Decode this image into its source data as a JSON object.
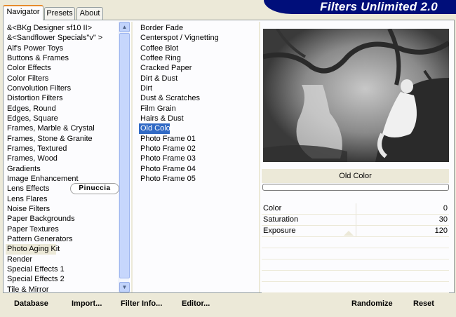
{
  "app": {
    "title": "Filters Unlimited 2.0"
  },
  "tabs": [
    {
      "label": "Navigator",
      "active": true
    },
    {
      "label": "Presets",
      "active": false
    },
    {
      "label": "About",
      "active": false
    }
  ],
  "categories": [
    "&<BKg Designer sf10 II>",
    "&<Sandflower Specials\"v\" >",
    "Alf's Power Toys",
    "Buttons & Frames",
    "Color Effects",
    "Color Filters",
    "Convolution Filters",
    "Distortion Filters",
    "Edges, Round",
    "Edges, Square",
    "Frames, Marble & Crystal",
    "Frames, Stone & Granite",
    "Frames, Textured",
    "Frames, Wood",
    "Gradients",
    "Image Enhancement",
    "Lens Effects",
    "Lens Flares",
    "Noise Filters",
    "Paper Backgrounds",
    "Paper Textures",
    "Pattern Generators",
    "Photo Aging Kit",
    "Render",
    "Special Effects 1",
    "Special Effects 2",
    "Tile & Mirror"
  ],
  "selected_category": "Photo Aging Kit",
  "filters": [
    "Border Fade",
    "Centerspot / Vignetting",
    "Coffee Blot",
    "Coffee Ring",
    "Cracked Paper",
    "Dirt & Dust",
    "Dirt",
    "Dust & Scratches",
    "Film Grain",
    "Hairs & Dust",
    "Old Color",
    "Photo Frame 01",
    "Photo Frame 02",
    "Photo Frame 03",
    "Photo Frame 04",
    "Photo Frame 05"
  ],
  "selected_filter": "Old Color",
  "preview": {
    "filter_name": "Old Color"
  },
  "params": [
    {
      "name": "Color",
      "value": "0"
    },
    {
      "name": "Saturation",
      "value": "30"
    },
    {
      "name": "Exposure",
      "value": "120"
    }
  ],
  "watermark": "Pinuccia",
  "scroll": {
    "up_icon": "▲",
    "down_icon": "▼"
  },
  "toolbar": {
    "database": "Database",
    "import": "Import...",
    "filter_info": "Filter Info...",
    "editor": "Editor...",
    "randomize": "Randomize",
    "reset": "Reset"
  },
  "colors": {
    "title_banner": "#000e7a",
    "selection_blue": "#316ac5",
    "window_bg": "#ece9d8"
  }
}
